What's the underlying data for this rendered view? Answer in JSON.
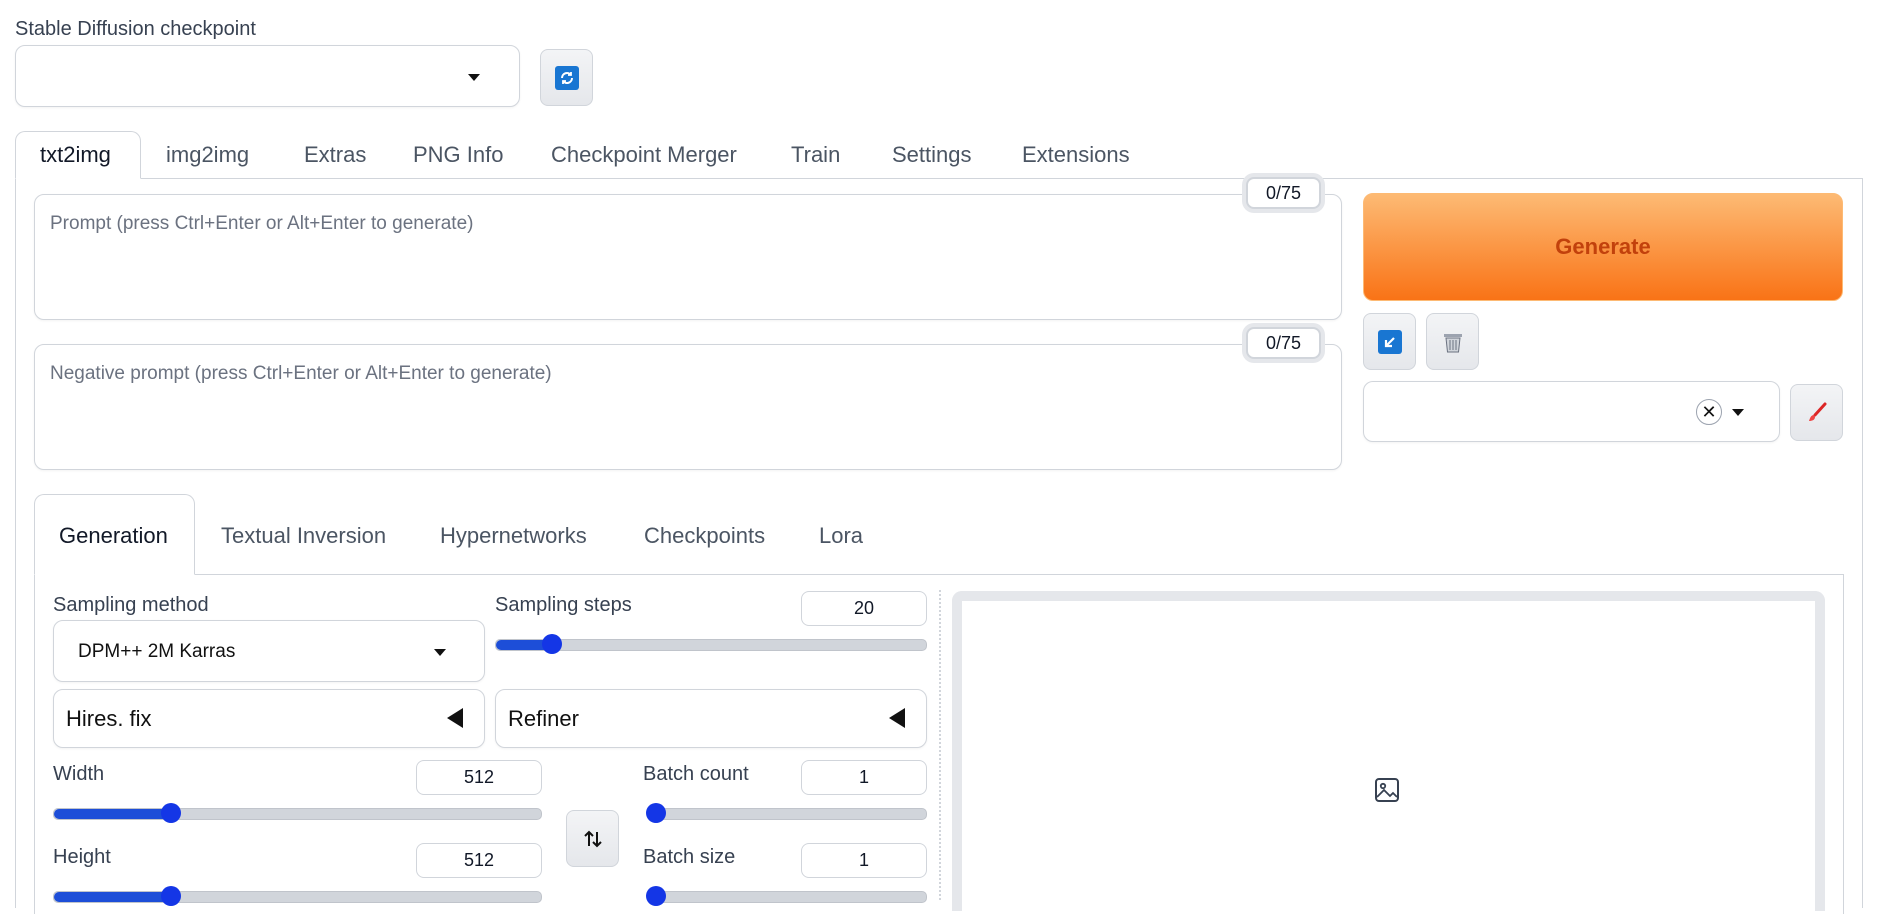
{
  "checkpoint": {
    "label": "Stable Diffusion checkpoint",
    "value": ""
  },
  "main_tabs": [
    {
      "label": "txt2img"
    },
    {
      "label": "img2img"
    },
    {
      "label": "Extras"
    },
    {
      "label": "PNG Info"
    },
    {
      "label": "Checkpoint Merger"
    },
    {
      "label": "Train"
    },
    {
      "label": "Settings"
    },
    {
      "label": "Extensions"
    }
  ],
  "prompt": {
    "placeholder": "Prompt (press Ctrl+Enter or Alt+Enter to generate)",
    "token_count": "0/75"
  },
  "negative_prompt": {
    "placeholder": "Negative prompt (press Ctrl+Enter or Alt+Enter to generate)",
    "token_count": "0/75"
  },
  "generate": {
    "label": "Generate",
    "color_top": "#fdba74",
    "color_bottom": "#f97316",
    "text_color": "#c2410c"
  },
  "sub_tabs": [
    {
      "label": "Generation"
    },
    {
      "label": "Textual Inversion"
    },
    {
      "label": "Hypernetworks"
    },
    {
      "label": "Checkpoints"
    },
    {
      "label": "Lora"
    }
  ],
  "sampling_method": {
    "label": "Sampling method",
    "value": "DPM++ 2M Karras"
  },
  "sampling_steps": {
    "label": "Sampling steps",
    "value": "20",
    "fraction": 0.13
  },
  "hires_fix": {
    "label": "Hires. fix"
  },
  "refiner": {
    "label": "Refiner"
  },
  "width": {
    "label": "Width",
    "value": "512",
    "fraction": 0.24
  },
  "height": {
    "label": "Height",
    "value": "512",
    "fraction": 0.24
  },
  "batch_count": {
    "label": "Batch count",
    "value": "1",
    "fraction": 0.0
  },
  "batch_size": {
    "label": "Batch size",
    "value": "1",
    "fraction": 0.0
  },
  "icons": {
    "refresh": "refresh-icon",
    "paste": "arrow-down-left-icon",
    "trash": "trash-icon",
    "clear": "close-circle-icon",
    "brush": "paintbrush-icon",
    "swap": "swap-vertical-icon",
    "image": "image-icon"
  },
  "accent": "#1d4ed8"
}
